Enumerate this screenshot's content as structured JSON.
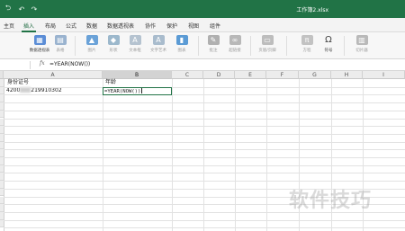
{
  "window": {
    "title": "工作簿2.xlsx",
    "quick_access": [
      {
        "name": "back",
        "icon": "back-arrow-icon"
      },
      {
        "name": "undo",
        "icon": "undo-icon"
      },
      {
        "name": "redo",
        "icon": "redo-icon"
      }
    ]
  },
  "tabs": [
    "主页",
    "插入",
    "布局",
    "公式",
    "数据",
    "数据透视表",
    "协作",
    "保护",
    "视图",
    "组件"
  ],
  "active_tab": "插入",
  "ribbon": {
    "buttons": [
      {
        "label": "数据透视表",
        "icon": "pivot-table-icon",
        "color": "#5b8dd6"
      },
      {
        "label": "表格",
        "icon": "table-icon",
        "color": "#9ab3cf"
      },
      {
        "label": "图片",
        "icon": "picture-icon",
        "color": "#6aa2d8"
      },
      {
        "label": "形状",
        "icon": "shapes-icon",
        "color": "#9cb8cc"
      },
      {
        "label": "文本框",
        "icon": "textbox-icon",
        "color": "#b5c3d0"
      },
      {
        "label": "文字艺术",
        "icon": "wordart-icon",
        "color": "#a9bccd"
      },
      {
        "label": "图表",
        "icon": "chart-icon",
        "color": "#5b9bd5"
      },
      {
        "label": "批注",
        "icon": "comment-icon",
        "color": "#b0b0b0"
      },
      {
        "label": "超链接",
        "icon": "hyperlink-icon",
        "color": "#b8b8b8"
      },
      {
        "label": "页眉/页脚",
        "icon": "header-footer-icon",
        "color": "#bdbdbd"
      },
      {
        "label": "方程",
        "icon": "equation-icon",
        "color": "#c2c2c2"
      },
      {
        "label": "符号",
        "icon": "omega-symbol-icon",
        "color": "#555555"
      },
      {
        "label": "切片器",
        "icon": "slicer-icon",
        "color": "#b9b9b9"
      }
    ]
  },
  "formula_bar": {
    "name_box": "",
    "fx_label": "fx",
    "formula": "=YEAR(NOW())"
  },
  "sheet": {
    "columns": [
      "A",
      "B",
      "C",
      "D",
      "E",
      "F",
      "G",
      "H",
      "I"
    ],
    "selected_column": "B",
    "cells": {
      "A1": "身份证号",
      "B1": "年龄",
      "A2_prefix": "4200",
      "A2_suffix": "219910302",
      "B2": "=YEAR(NOW())"
    }
  },
  "watermark": "软件技巧",
  "colors": {
    "accent": "#217346",
    "header_bg": "#ececec",
    "grid_line": "#e2e2e2"
  }
}
